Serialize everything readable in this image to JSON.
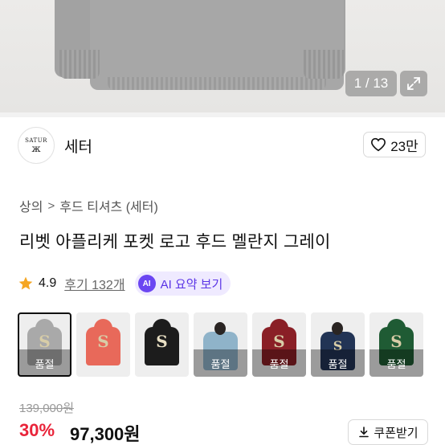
{
  "gallery": {
    "counter": "1 / 13",
    "expand_icon": "expand-icon"
  },
  "seller": {
    "logo_text": "SATUR",
    "logo_mark": "ж",
    "name": "세터",
    "like_icon": "heart-icon",
    "like_count": "23만"
  },
  "breadcrumb": {
    "items": [
      "상의",
      "후드 티셔츠 (세터)"
    ],
    "separator": ">"
  },
  "product": {
    "title": "리벳 아플리케 포켓 로고 후드 멜란지 그레이",
    "rating": "4.9",
    "review_link": "후기 132개",
    "ai_badge": "AI",
    "ai_button_label": "AI 요약 보기",
    "rating_color": "#f5a623"
  },
  "options": [
    {
      "color": "#a9a9a9",
      "soldout": "품절",
      "selected": true
    },
    {
      "color": "#e8695a",
      "soldout": "",
      "selected": false
    },
    {
      "color": "#1c1c1c",
      "soldout": "",
      "selected": false
    },
    {
      "color": "#8fb3c9",
      "soldout": "품절",
      "selected": false
    },
    {
      "color": "#8a1f26",
      "soldout": "품절",
      "selected": false
    },
    {
      "color": "#223455",
      "soldout": "품절",
      "selected": false
    },
    {
      "color": "#1f5b34",
      "soldout": "품절",
      "selected": false
    }
  ],
  "price": {
    "original": "139,000원",
    "discount": "30%",
    "sale": "97,300원",
    "coupon_label": "쿠폰받기",
    "discount_color": "#e9243a"
  }
}
